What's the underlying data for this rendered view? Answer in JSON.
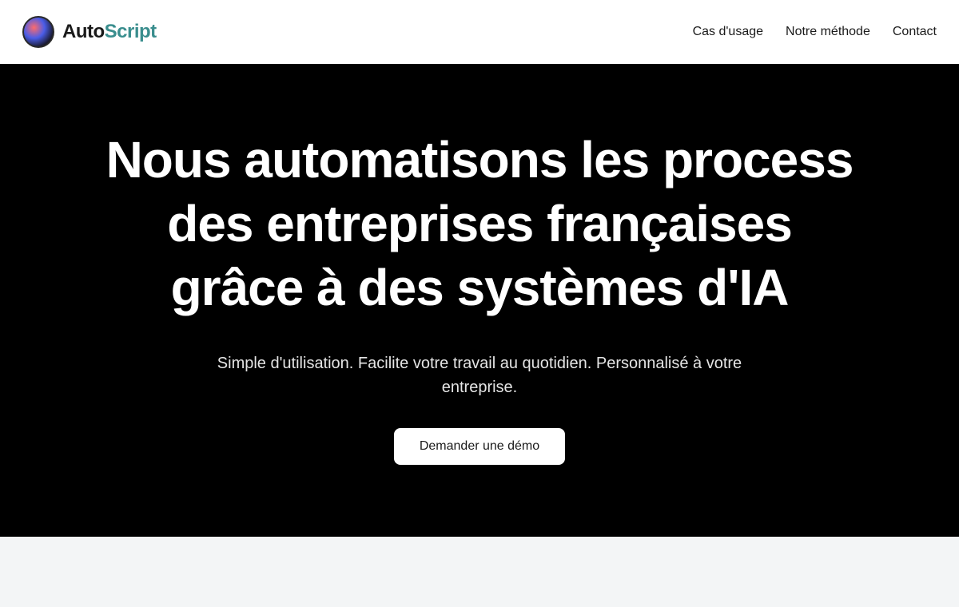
{
  "header": {
    "logo": {
      "text_primary": "Auto",
      "text_secondary": "Script"
    },
    "nav": [
      {
        "label": "Cas d'usage"
      },
      {
        "label": "Notre méthode"
      },
      {
        "label": "Contact"
      }
    ]
  },
  "hero": {
    "title": "Nous automatisons les process\ndes entreprises françaises\ngrâce à des systèmes d'IA",
    "subtitle": "Simple d'utilisation. Facilite votre travail au quotidien. Personnalisé à votre\nentreprise.",
    "cta_label": "Demander une démo"
  }
}
